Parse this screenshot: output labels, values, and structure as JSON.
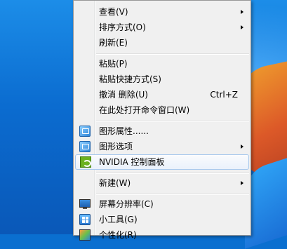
{
  "context_menu": {
    "items": [
      {
        "label": "查看(V)",
        "has_submenu": true
      },
      {
        "label": "排序方式(O)",
        "has_submenu": true
      },
      {
        "label": "刷新(E)"
      },
      {
        "label": "粘贴(P)"
      },
      {
        "label": "粘贴快捷方式(S)"
      },
      {
        "label": "撤消 删除(U)",
        "shortcut": "Ctrl+Z"
      },
      {
        "label": "在此处打开命令窗口(W)"
      },
      {
        "label": "图形属性......",
        "icon": "graphics-properties-icon"
      },
      {
        "label": "图形选项",
        "icon": "graphics-options-icon",
        "has_submenu": true
      },
      {
        "label": "NVIDIA 控制面板",
        "icon": "nvidia-icon",
        "highlighted": true
      },
      {
        "label": "新建(W)",
        "has_submenu": true
      },
      {
        "label": "屏幕分辨率(C)",
        "icon": "screen-resolution-icon"
      },
      {
        "label": "小工具(G)",
        "icon": "gadgets-icon"
      },
      {
        "label": "个性化(R)",
        "icon": "personalize-icon"
      }
    ]
  }
}
